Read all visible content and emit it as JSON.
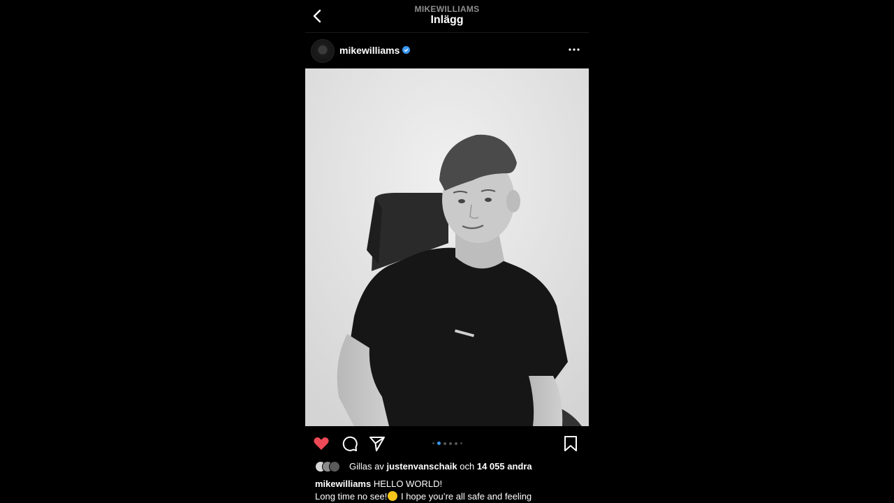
{
  "header": {
    "subtitle": "MIKEWILLIAMS",
    "title": "Inlägg"
  },
  "post": {
    "username": "mikewilliams",
    "verified": true,
    "carousel": {
      "count": 6,
      "active": 1
    },
    "liked": true,
    "likes": {
      "prefix": "Gillas av",
      "user": "justenvanschaik",
      "connector": "och",
      "count": "14 055 andra"
    },
    "caption": {
      "username": "mikewilliams",
      "line1": "HELLO WORLD!",
      "line2_a": "Long time no see!",
      "line2_b": " I hope you’re all safe and feeling"
    }
  },
  "colors": {
    "like": "#ed4956",
    "verified": "#3897f0",
    "muted": "#8e8e8e"
  },
  "icons": [
    "back-chevron-icon",
    "more-icon",
    "heart-icon",
    "comment-icon",
    "share-icon",
    "bookmark-icon",
    "verified-icon",
    "smiley-emoji"
  ]
}
